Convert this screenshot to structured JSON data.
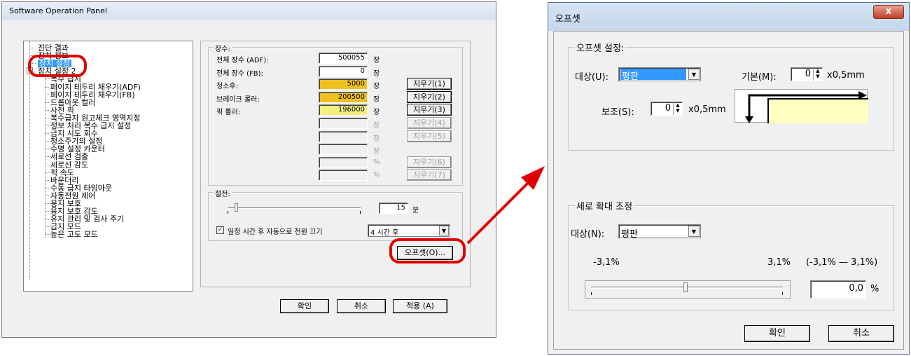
{
  "win1": {
    "title": "Software Operation Panel",
    "tree": [
      "진단 결과",
      "장치 정보",
      "장치 설정",
      "장치 설정 2",
      "복수 급지",
      "페이지 테두리 채우기(ADF)",
      "페이지 테두리 채우기(FB)",
      "드롭아웃 컬러",
      "사전 픽",
      "복수급지 원고체크 영역지정",
      "정보 처리 복수 급지 설정",
      "급지 시도 회수",
      "청소주기의 설정",
      "수명 설정 카운터",
      "세로선 검출",
      "세로선 감도",
      "픽 속도",
      "바운더리",
      "수동 급지 타임아웃",
      "자동전원 제어",
      "용지 보호",
      "용지 보호 감도",
      "유지 관리 및 검사 주기",
      "급지 모드",
      "높은 고도 모드"
    ],
    "counts_group": "장수:",
    "counters": [
      {
        "label": "전체 장수 (ADF):",
        "value": "500055",
        "unit": "장",
        "button": ""
      },
      {
        "label": "전체 장수 (FB):",
        "value": "0",
        "unit": "장",
        "button": ""
      },
      {
        "label": "청소후:",
        "value": "5000",
        "unit": "장",
        "button": "지우기(1)"
      },
      {
        "label": "브레이크 롤러:",
        "value": "200500",
        "unit": "장",
        "button": "지우기(2)"
      },
      {
        "label": "픽 롤러:",
        "value": "196000",
        "unit": "장",
        "button": "지우기(3)"
      },
      {
        "label": "",
        "value": "",
        "unit": "장",
        "button": "지우기(4)"
      },
      {
        "label": "",
        "value": "",
        "unit": "장",
        "button": "지우기(5)"
      },
      {
        "label": "",
        "value": "",
        "unit": "장",
        "button": ""
      },
      {
        "label": "",
        "value": "",
        "unit": "%",
        "button": "지우기(6)"
      },
      {
        "label": "",
        "value": "",
        "unit": "%",
        "button": "지우기(7)"
      }
    ],
    "power_group": "절전:",
    "power_minutes": "15",
    "power_unit": "분",
    "auto_off_label": "일정 시간 후 자동으로 전원 끄기",
    "auto_off_value": "4 시간 후",
    "offset_button": "오프셋(O)...",
    "ok": "확인",
    "cancel": "취소",
    "apply": "적용 (A)"
  },
  "win2": {
    "title": "오프셋",
    "close": "X",
    "group1": "오프셋 설정:",
    "target_label": "대상(U):",
    "target_value": "평판",
    "base_label": "기본(M):",
    "base_value": "0",
    "base_unit": "x0,5mm",
    "sub_label": "보조(S):",
    "sub_value": "0",
    "sub_unit": "x0,5mm",
    "group2": "세로 확대 조정",
    "target2_label": "대상(N):",
    "target2_value": "평판",
    "min": "-3,1%",
    "max": "3,1%",
    "range": "(-3,1% — 3,1%)",
    "scale_value": "0,0",
    "scale_unit": "%",
    "ok": "확인",
    "cancel": "취소"
  },
  "colors": {
    "highlight": "#3399ff",
    "callout": "#e00000",
    "counter_dark": "#f0c020",
    "counter_light": "#f4f080"
  }
}
